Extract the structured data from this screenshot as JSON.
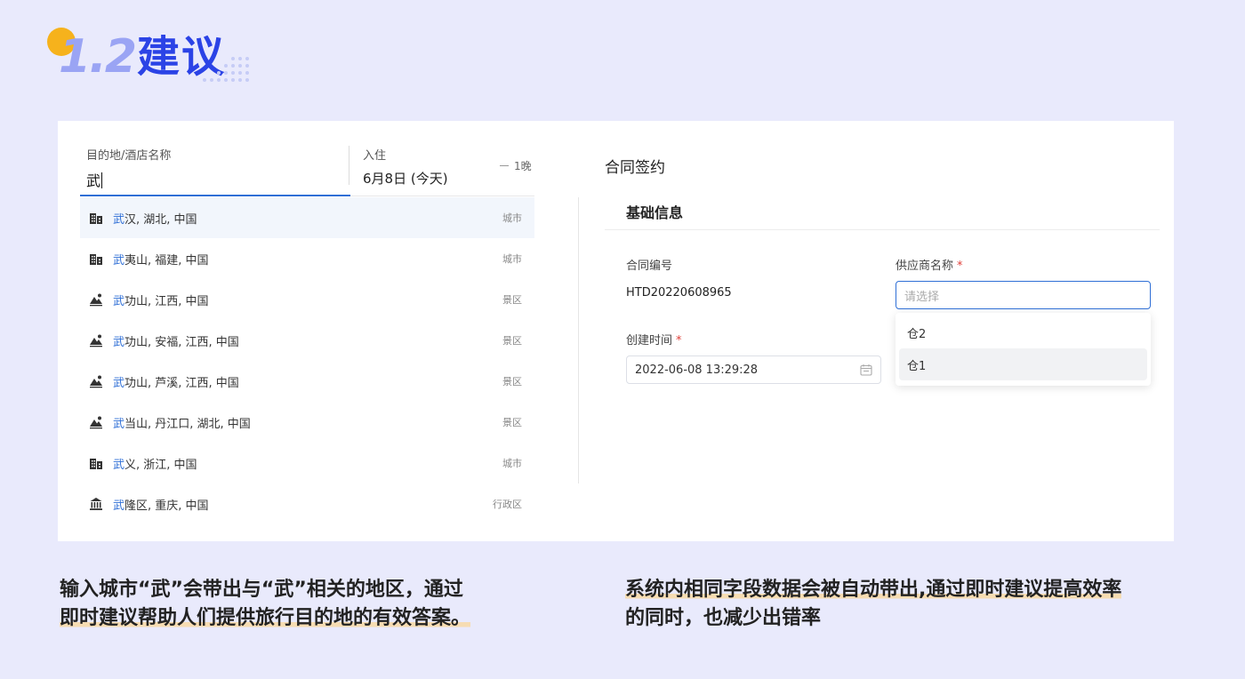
{
  "header": {
    "number": "1.2",
    "title": "建议"
  },
  "search": {
    "dest_label": "目的地/酒店名称",
    "dest_value": "武",
    "checkin_label": "入住",
    "checkin_value": "6月8日 (今天)",
    "nights": "1晚",
    "suggestions": [
      {
        "hl": "武",
        "rest": "汉, 湖北, 中国",
        "type": "城市",
        "icon": "city-icon"
      },
      {
        "hl": "武",
        "rest": "夷山, 福建, 中国",
        "type": "城市",
        "icon": "city-icon"
      },
      {
        "hl": "武",
        "rest": "功山, 江西, 中国",
        "type": "景区",
        "icon": "mountain-icon"
      },
      {
        "hl": "武",
        "rest": "功山, 安福, 江西, 中国",
        "type": "景区",
        "icon": "mountain-icon"
      },
      {
        "hl": "武",
        "rest": "功山, 芦溪, 江西, 中国",
        "type": "景区",
        "icon": "mountain-icon"
      },
      {
        "hl": "武",
        "rest": "当山, 丹江口, 湖北, 中国",
        "type": "景区",
        "icon": "mountain-icon"
      },
      {
        "hl": "武",
        "rest": "义, 浙江, 中国",
        "type": "城市",
        "icon": "city-icon"
      },
      {
        "hl": "武",
        "rest": "隆区, 重庆, 中国",
        "type": "行政区",
        "icon": "government-icon"
      }
    ]
  },
  "form": {
    "title": "合同签约",
    "section": "基础信息",
    "contract_no_label": "合同编号",
    "contract_no_value": "HTD20220608965",
    "supplier_label": "供应商名称",
    "required_mark": "*",
    "supplier_placeholder": "请选择",
    "created_label": "创建时间",
    "created_value": "2022-06-08 13:29:28",
    "options": [
      "仓2",
      "仓1"
    ]
  },
  "captions": {
    "left_line1": "输入城市“武”会带出与“武”相关的地区，通过",
    "left_line2": "即时建议帮助人们提供旅行目的地的有效答案。",
    "right_line1": "系统内相同字段数据会被自动带出,通过即时建议提高效率",
    "right_line2": "的同时，也减少出错率"
  },
  "colors": {
    "accent": "#2f6fd6",
    "title_blue": "#2b43e6",
    "dot_orange": "#f6b21c",
    "background": "#e9eafc",
    "highlight_underline": "#f6dcb2"
  }
}
